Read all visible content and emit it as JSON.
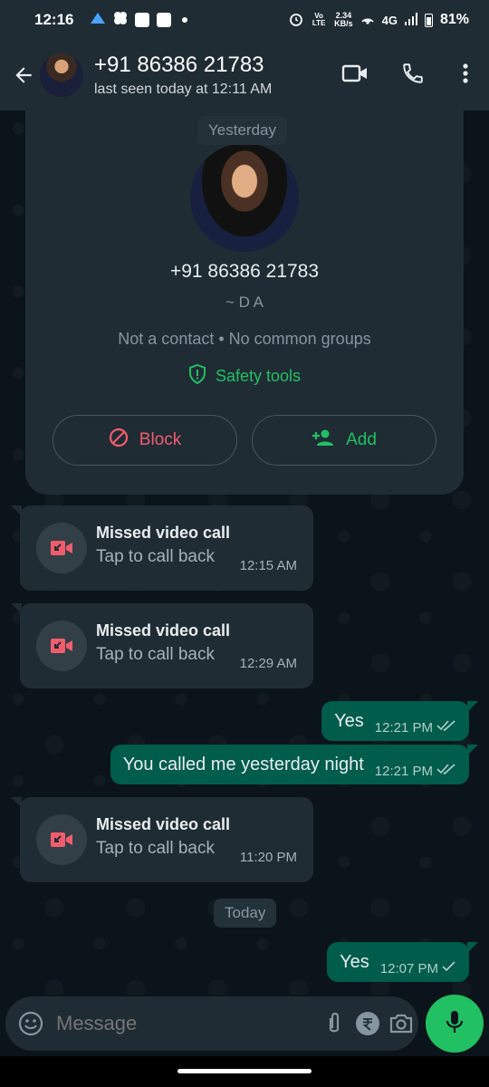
{
  "status_bar": {
    "time": "12:16",
    "speed_top": "2.34",
    "speed_bottom": "KB/s",
    "volte": "Vo LTE",
    "network": "4G",
    "battery": "81%"
  },
  "header": {
    "name": "+91 86386 21783",
    "status": "last seen today at 12:11 AM",
    "icons": [
      "back-arrow-icon",
      "video-call-icon",
      "phone-icon",
      "more-vert-icon"
    ]
  },
  "info_card": {
    "date_chip": "Yesterday",
    "number": "+91 86386 21783",
    "nickname": "~ D A",
    "meta": "Not a contact • No common groups",
    "safety": "Safety tools",
    "block": "Block",
    "add": "Add"
  },
  "messages": [
    {
      "type": "call",
      "title": "Missed video call",
      "sub": "Tap to call back",
      "time": "12:15 AM"
    },
    {
      "type": "call",
      "title": "Missed video call",
      "sub": "Tap to call back",
      "time": "12:29 AM"
    },
    {
      "type": "out",
      "text": "Yes",
      "time": "12:21 PM",
      "ticks": "double"
    },
    {
      "type": "out",
      "text": "You called me yesterday night",
      "time": "12:21 PM",
      "ticks": "double"
    },
    {
      "type": "call",
      "title": "Missed video call",
      "sub": "Tap to call back",
      "time": "11:20 PM"
    },
    {
      "type": "out",
      "text": "Yes",
      "time": "12:07 PM",
      "ticks": "single"
    }
  ],
  "date_today": "Today",
  "composer": {
    "placeholder": "Message"
  },
  "colors": {
    "accent": "#21c063",
    "outgoing": "#005c4b",
    "incoming": "#1f2c34",
    "danger": "#f15c6d"
  }
}
